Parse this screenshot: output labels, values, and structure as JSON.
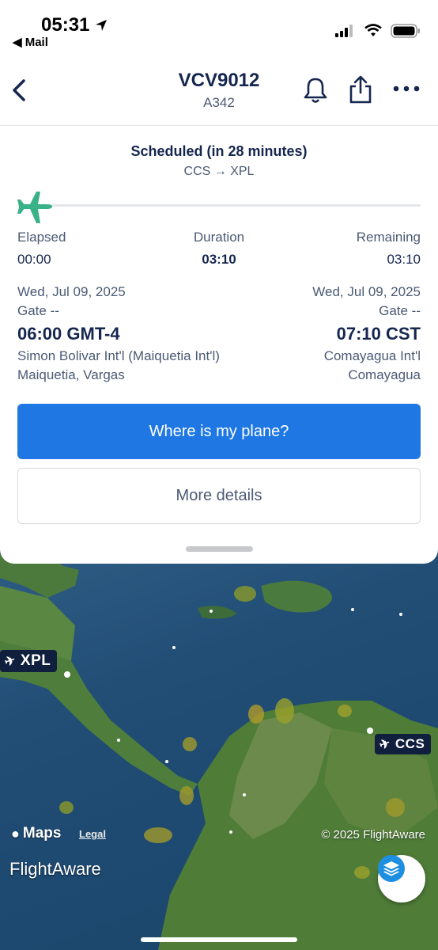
{
  "status_bar": {
    "time": "05:31",
    "back_app": "◀ Mail"
  },
  "nav": {
    "flight_number": "VCV9012",
    "aircraft": "A342"
  },
  "flight": {
    "status": "Scheduled (in 28 minutes)",
    "route": "CCS → XPL",
    "progress": 0,
    "elapsed_label": "Elapsed",
    "elapsed": "00:00",
    "duration_label": "Duration",
    "duration": "03:10",
    "remaining_label": "Remaining",
    "remaining": "03:10",
    "departure": {
      "date": "Wed, Jul 09, 2025",
      "gate": "Gate --",
      "time": "06:00 GMT-4",
      "airport": "Simon Bolivar Int'l (Maiquetia Int'l)",
      "city": "Maiquetia, Vargas"
    },
    "arrival": {
      "date": "Wed, Jul 09, 2025",
      "gate": "Gate --",
      "time": "07:10 CST",
      "airport": "Comayagua Int'l",
      "city": "Comayagua"
    }
  },
  "buttons": {
    "where_is_plane": "Where is my plane?",
    "more_details": "More details"
  },
  "map": {
    "dest_tag": "XPL",
    "origin_tag": "CCS",
    "maps_brand": "Maps",
    "legal": "Legal",
    "copyright": "© 2025 FlightAware",
    "logo": "FlightAware"
  },
  "colors": {
    "accent": "#1e77e3",
    "navy": "#15264f",
    "plane_green": "#38b286"
  }
}
